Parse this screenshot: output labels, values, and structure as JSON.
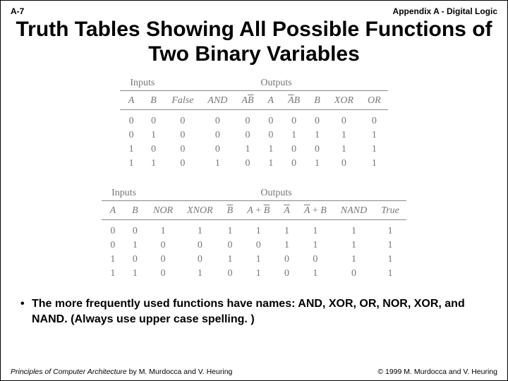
{
  "header": {
    "page_label": "A-7",
    "appendix": "Appendix A - Digital Logic"
  },
  "title": "Truth Tables Showing All Possible Functions of Two Binary Variables",
  "table1": {
    "group_inputs": "Inputs",
    "group_outputs": "Outputs",
    "cols": {
      "A": "A",
      "B": "B",
      "f0": "False",
      "f1": "AND",
      "f2": "A B̅",
      "f3": "A",
      "f4": "A̅ B",
      "f5": "B",
      "f6": "XOR",
      "f7": "OR"
    },
    "rows": [
      {
        "A": "0",
        "B": "0",
        "f0": "0",
        "f1": "0",
        "f2": "0",
        "f3": "0",
        "f4": "0",
        "f5": "0",
        "f6": "0",
        "f7": "0"
      },
      {
        "A": "0",
        "B": "1",
        "f0": "0",
        "f1": "0",
        "f2": "0",
        "f3": "0",
        "f4": "1",
        "f5": "1",
        "f6": "1",
        "f7": "1"
      },
      {
        "A": "1",
        "B": "0",
        "f0": "0",
        "f1": "0",
        "f2": "1",
        "f3": "1",
        "f4": "0",
        "f5": "0",
        "f6": "1",
        "f7": "1"
      },
      {
        "A": "1",
        "B": "1",
        "f0": "0",
        "f1": "1",
        "f2": "0",
        "f3": "1",
        "f4": "0",
        "f5": "1",
        "f6": "0",
        "f7": "1"
      }
    ]
  },
  "table2": {
    "group_inputs": "Inputs",
    "group_outputs": "Outputs",
    "cols": {
      "A": "A",
      "B": "B",
      "f0": "NOR",
      "f1": "XNOR",
      "f2": "B̅",
      "f3": "A + B̅",
      "f4": "A̅",
      "f5": "A̅ + B",
      "f6": "NAND",
      "f7": "True"
    },
    "rows": [
      {
        "A": "0",
        "B": "0",
        "f0": "1",
        "f1": "1",
        "f2": "1",
        "f3": "1",
        "f4": "1",
        "f5": "1",
        "f6": "1",
        "f7": "1"
      },
      {
        "A": "0",
        "B": "1",
        "f0": "0",
        "f1": "0",
        "f2": "0",
        "f3": "0",
        "f4": "1",
        "f5": "1",
        "f6": "1",
        "f7": "1"
      },
      {
        "A": "1",
        "B": "0",
        "f0": "0",
        "f1": "0",
        "f2": "1",
        "f3": "1",
        "f4": "0",
        "f5": "0",
        "f6": "1",
        "f7": "1"
      },
      {
        "A": "1",
        "B": "1",
        "f0": "0",
        "f1": "1",
        "f2": "0",
        "f3": "1",
        "f4": "0",
        "f5": "1",
        "f6": "0",
        "f7": "1"
      }
    ]
  },
  "bullet_text": "The more frequently used functions have names: AND, XOR, OR, NOR, XOR, and NAND. (Always use upper case spelling. )",
  "footer": {
    "book_title": "Principles of Computer Architecture",
    "book_by": " by M. Murdocca and V. Heuring",
    "copyright": "© 1999 M. Murdocca and V. Heuring"
  },
  "chart_data": [
    {
      "type": "table",
      "title": "Truth table — functions 0–7 of two binary variables",
      "columns": [
        "A",
        "B",
        "False",
        "AND",
        "A·B̄",
        "A",
        "Ā·B",
        "B",
        "XOR",
        "OR"
      ],
      "rows": [
        [
          0,
          0,
          0,
          0,
          0,
          0,
          0,
          0,
          0,
          0
        ],
        [
          0,
          1,
          0,
          0,
          0,
          0,
          1,
          1,
          1,
          1
        ],
        [
          1,
          0,
          0,
          0,
          1,
          1,
          0,
          0,
          1,
          1
        ],
        [
          1,
          1,
          0,
          1,
          0,
          1,
          0,
          1,
          0,
          1
        ]
      ]
    },
    {
      "type": "table",
      "title": "Truth table — functions 8–15 of two binary variables",
      "columns": [
        "A",
        "B",
        "NOR",
        "XNOR",
        "B̄",
        "A+B̄",
        "Ā",
        "Ā+B",
        "NAND",
        "True"
      ],
      "rows": [
        [
          0,
          0,
          1,
          1,
          1,
          1,
          1,
          1,
          1,
          1
        ],
        [
          0,
          1,
          0,
          0,
          0,
          0,
          1,
          1,
          1,
          1
        ],
        [
          1,
          0,
          0,
          0,
          1,
          1,
          0,
          0,
          1,
          1
        ],
        [
          1,
          1,
          0,
          1,
          0,
          1,
          0,
          1,
          0,
          1
        ]
      ]
    }
  ]
}
